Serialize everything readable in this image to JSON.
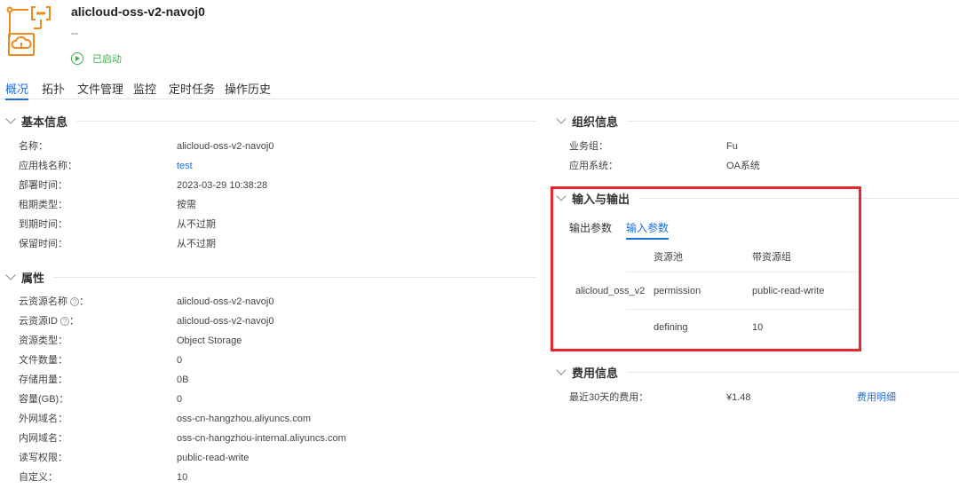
{
  "header": {
    "title": "alicloud-oss-v2-navoj0",
    "description": "--",
    "status": "已启动",
    "status_color": "#3fb14a",
    "accent_color": "#1e6fd9",
    "logo_icon": "cloud-storage-icon"
  },
  "tabs": [
    "概况",
    "拓扑",
    "文件管理",
    "监控",
    "定时任务",
    "操作历史"
  ],
  "basic": {
    "title": "基本信息",
    "rows": [
      {
        "label": "名称：",
        "value": "alicloud-oss-v2-navoj0"
      },
      {
        "label": "应用栈名称：",
        "value": "test"
      },
      {
        "label": "部署时间：",
        "value": "2023-03-29 10:38:28"
      },
      {
        "label": "租期类型：",
        "value": "按需"
      },
      {
        "label": "到期时间：",
        "value": "从不过期"
      },
      {
        "label": "保留时间：",
        "value": "从不过期"
      }
    ]
  },
  "props": {
    "title": "属性",
    "rows": [
      {
        "label": "云资源名称",
        "value": "alicloud-oss-v2-navoj0"
      },
      {
        "label": "云资源ID",
        "value": "alicloud-oss-v2-navoj0"
      },
      {
        "label": "资源类型：",
        "value": "Object Storage"
      },
      {
        "label": "文件数量：",
        "value": "0"
      },
      {
        "label": "存储用量：",
        "value": "0B"
      },
      {
        "label": "容量(GB)：",
        "value": "0"
      },
      {
        "label": "外网域名：",
        "value": "oss-cn-hangzhou.aliyuncs.com"
      },
      {
        "label": "内网域名：",
        "value": "oss-cn-hangzhou-internal.aliyuncs.com"
      },
      {
        "label": "读写权限：",
        "value": "public-read-write"
      },
      {
        "label": "自定义：",
        "value": "10"
      }
    ],
    "help_mark": "?",
    "colon": "："
  },
  "org": {
    "title": "组织信息",
    "rows": [
      {
        "label": "业务组：",
        "value": "Fu"
      },
      {
        "label": "应用系统：",
        "value": "OA系统"
      }
    ]
  },
  "io": {
    "title": "输入与输出",
    "tabs": [
      "输出参数",
      "输入参数"
    ],
    "active_tab": 1,
    "columns": [
      "资源池",
      "带资源组"
    ],
    "resource_name": "alicloud_oss_v2",
    "rows": [
      {
        "key": "permission",
        "value": "public-read-write"
      },
      {
        "key": "defining",
        "value": "10"
      }
    ]
  },
  "cost": {
    "title": "费用信息",
    "label": "最近30天的费用：",
    "value": "¥1.48",
    "link": "费用明细"
  }
}
